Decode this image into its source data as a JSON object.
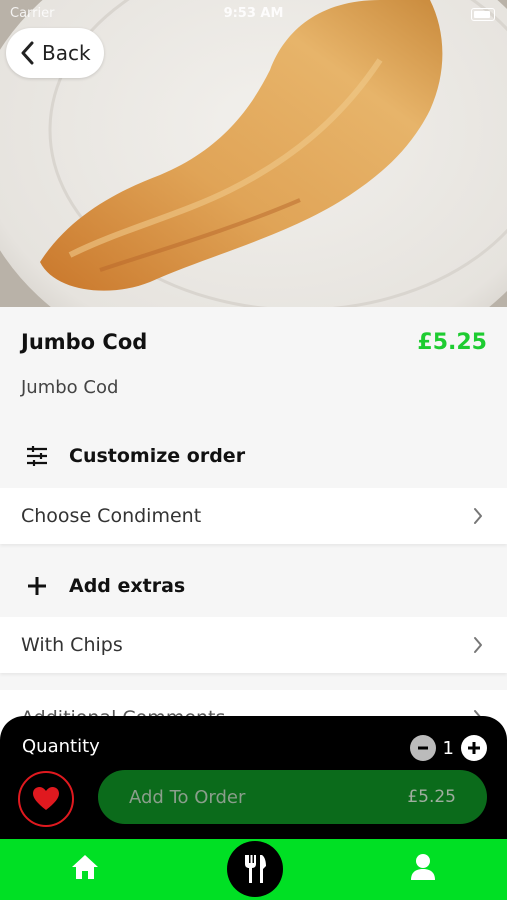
{
  "status_bar": {
    "carrier": "Carrier",
    "time": "9:53 AM"
  },
  "nav": {
    "back_label": "Back"
  },
  "product": {
    "name": "Jumbo Cod",
    "price": "£5.25",
    "description": "Jumbo Cod"
  },
  "customize": {
    "heading": "Customize order",
    "option_label": "Choose Condiment"
  },
  "extras": {
    "heading": "Add extras",
    "option_label": "With Chips"
  },
  "comments": {
    "label": "Additional Comments"
  },
  "order_bar": {
    "quantity_label": "Quantity",
    "quantity": "1",
    "add_label": "Add To Order",
    "add_price": "£5.25"
  },
  "tab_bar": {
    "items": [
      "home-icon",
      "cutlery-icon",
      "user-icon"
    ]
  },
  "colors": {
    "accent": "#1ecc31",
    "tab_bar": "#00e024",
    "add_button": "#0b6b1b",
    "favorite": "#e0191f"
  }
}
